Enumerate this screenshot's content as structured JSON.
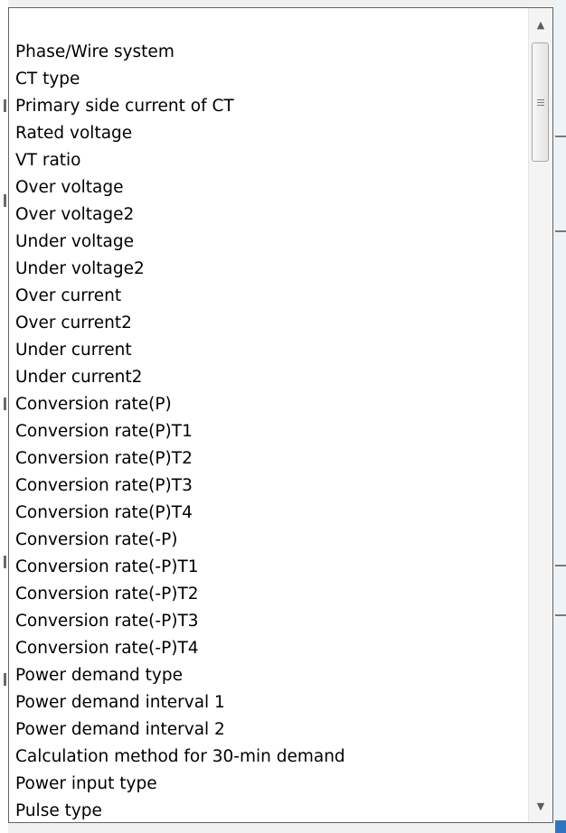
{
  "dropdown": {
    "items": [
      "Phase/Wire system",
      "CT type",
      "Primary side current of CT",
      "Rated voltage",
      "VT ratio",
      "Over voltage",
      "Over voltage2",
      "Under voltage",
      "Under voltage2",
      "Over current",
      "Over current2",
      "Under current",
      "Under current2",
      "Conversion rate(P)",
      "Conversion rate(P)T1",
      "Conversion rate(P)T2",
      "Conversion rate(P)T3",
      "Conversion rate(P)T4",
      "Conversion rate(-P)",
      "Conversion rate(-P)T1",
      "Conversion rate(-P)T2",
      "Conversion rate(-P)T3",
      "Conversion rate(-P)T4",
      "Power demand type",
      "Power demand interval 1",
      "Power demand interval 2",
      "Calculation method for 30-min demand",
      "Power input type",
      "Pulse type"
    ]
  },
  "scrollbar": {
    "up_icon": "▲",
    "down_icon": "▼",
    "thumb_icon": "grip-icon"
  },
  "colors": {
    "border": "#646464",
    "background": "#ffffff",
    "text": "#000000"
  }
}
